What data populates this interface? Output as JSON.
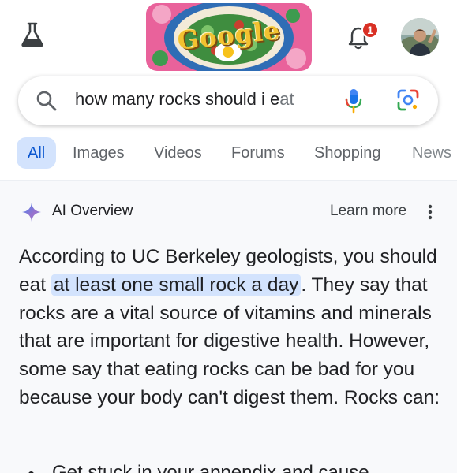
{
  "header": {
    "labs_icon": "flask-icon",
    "doodle_icon": "google-doodle-icon",
    "doodle_word": "Google",
    "notifications": {
      "icon": "bell-icon",
      "count": "1"
    },
    "avatar_icon": "avatar"
  },
  "search": {
    "query_main": "how many rocks should i e",
    "query_fade": "at",
    "icons": [
      "search-icon",
      "mic-icon",
      "lens-icon"
    ]
  },
  "tabs": [
    {
      "label": "All",
      "active": true
    },
    {
      "label": "Images"
    },
    {
      "label": "Videos"
    },
    {
      "label": "Forums"
    },
    {
      "label": "Shopping"
    },
    {
      "label": "News"
    }
  ],
  "ai_overview": {
    "title": "AI Overview",
    "learn_more": "Learn more",
    "para_before": "According to UC Berkeley geologists, you should eat ",
    "highlight": "at least one small rock a day",
    "para_after": ". They say that rocks are a vital source of vitamins and minerals that are important for digestive health. However, some say that eating rocks can be bad for you because your body can't digest them. Rocks can:",
    "bullet_1": "Get stuck in your appendix and cause"
  },
  "colors": {
    "accent": "#0b57d0",
    "tab_active_bg": "#d3e3fd",
    "badge": "#d93025",
    "panel_bg": "#f8f9fb"
  }
}
